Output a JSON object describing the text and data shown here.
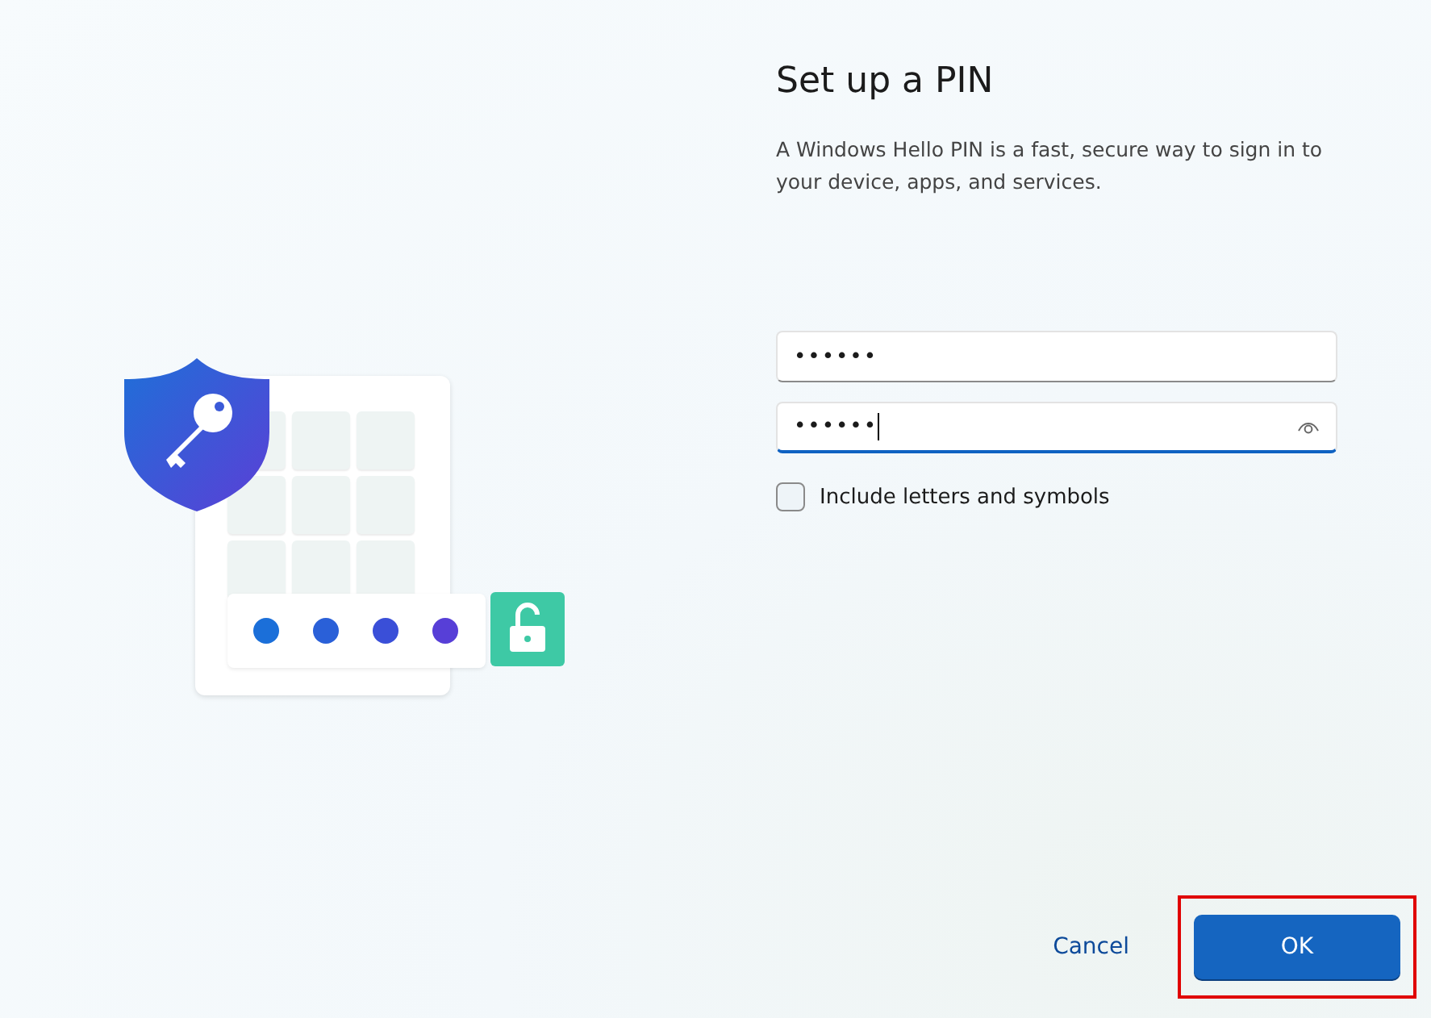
{
  "title": "Set up a PIN",
  "description": "A Windows Hello PIN is a fast, secure way to sign in to your device, apps, and services.",
  "fields": [
    {
      "value": "••••••",
      "focused": false,
      "reveal_icon": false
    },
    {
      "value": "••••••",
      "focused": true,
      "reveal_icon": true
    }
  ],
  "checkbox": {
    "label": "Include letters and symbols",
    "checked": false
  },
  "buttons": [
    {
      "label": "Cancel",
      "kind": "link",
      "highlighted": false
    },
    {
      "label": "OK",
      "kind": "primary",
      "highlighted": true
    }
  ]
}
